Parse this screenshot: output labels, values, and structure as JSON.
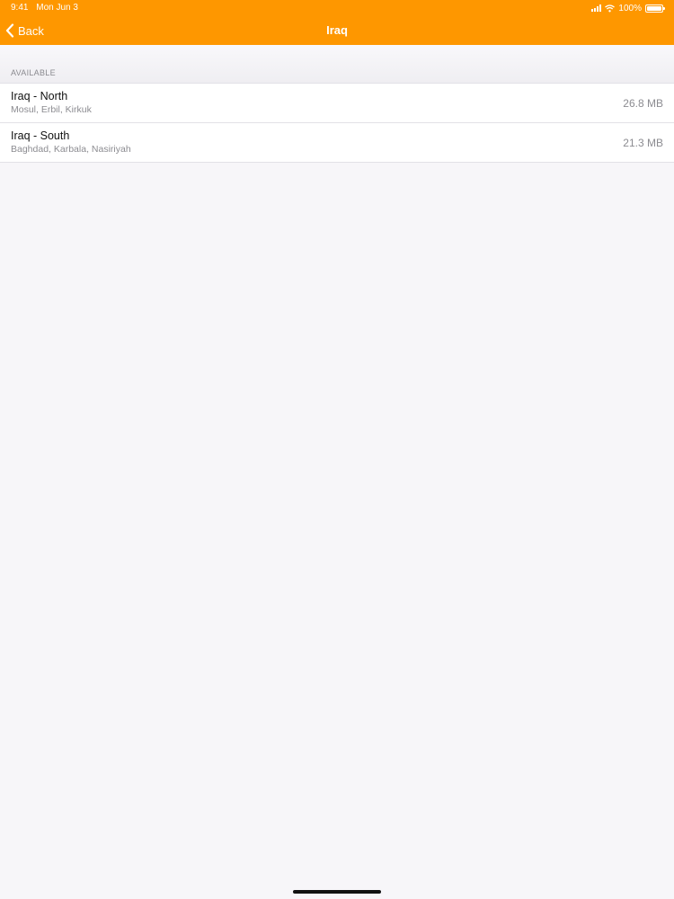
{
  "status_bar": {
    "time": "9:41",
    "date": "Mon Jun 3",
    "battery": "100%",
    "icons": [
      "cellular-signal-icon",
      "wifi-icon",
      "battery-icon"
    ]
  },
  "nav": {
    "back_label": "Back",
    "title": "Iraq"
  },
  "section": {
    "header": "AVAILABLE"
  },
  "regions": [
    {
      "name": "Iraq - North",
      "cities": "Mosul, Erbil, Kirkuk",
      "size": "26.8 MB"
    },
    {
      "name": "Iraq - South",
      "cities": "Baghdad, Karbala, Nasiriyah",
      "size": "21.3 MB"
    }
  ],
  "colors": {
    "accent": "#fe9700",
    "background": "#f7f6f9"
  }
}
